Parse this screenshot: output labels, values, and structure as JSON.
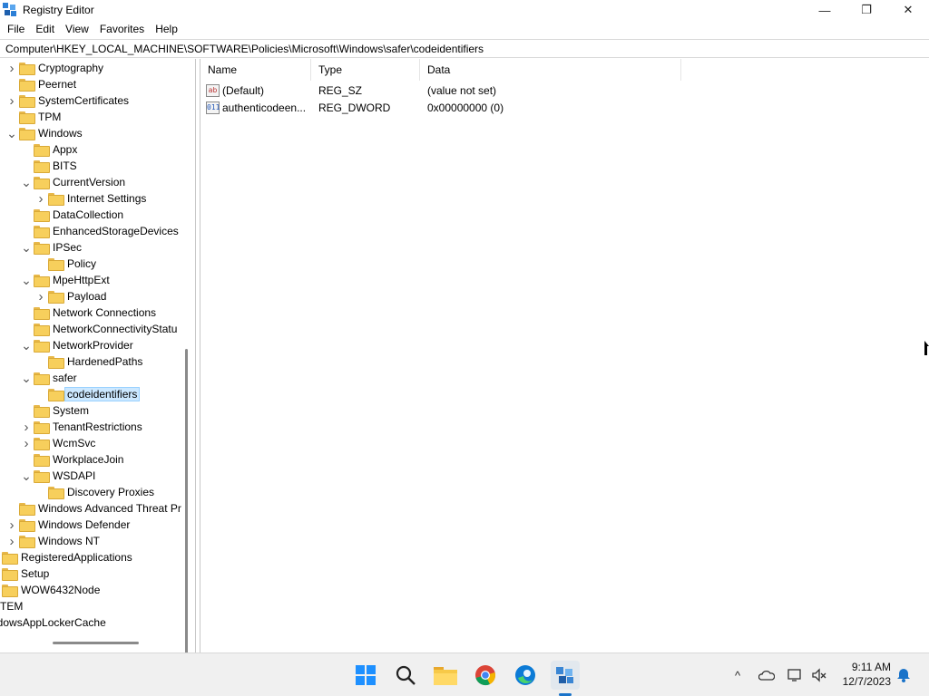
{
  "window": {
    "title": "Registry Editor",
    "minimize": "—",
    "maximize": "❐",
    "close": "✕"
  },
  "menu": [
    "File",
    "Edit",
    "View",
    "Favorites",
    "Help"
  ],
  "address": "Computer\\HKEY_LOCAL_MACHINE\\SOFTWARE\\Policies\\Microsoft\\Windows\\safer\\codeidentifiers",
  "tree": [
    {
      "label": "Cryptography",
      "chevron": "right"
    },
    {
      "label": "Peernet",
      "chevron": ""
    },
    {
      "label": "SystemCertificates",
      "chevron": "right"
    },
    {
      "label": "TPM",
      "chevron": ""
    },
    {
      "label": "Windows",
      "chevron": "down"
    },
    {
      "label": "Appx",
      "chevron": ""
    },
    {
      "label": "BITS",
      "chevron": ""
    },
    {
      "label": "CurrentVersion",
      "chevron": "down"
    },
    {
      "label": "Internet Settings",
      "chevron": "right"
    },
    {
      "label": "DataCollection",
      "chevron": ""
    },
    {
      "label": "EnhancedStorageDevices",
      "chevron": ""
    },
    {
      "label": "IPSec",
      "chevron": "down"
    },
    {
      "label": "Policy",
      "chevron": ""
    },
    {
      "label": "MpeHttpExt",
      "chevron": "down"
    },
    {
      "label": "Payload",
      "chevron": "right"
    },
    {
      "label": "Network Connections",
      "chevron": ""
    },
    {
      "label": "NetworkConnectivityStatu",
      "chevron": ""
    },
    {
      "label": "NetworkProvider",
      "chevron": "down"
    },
    {
      "label": "HardenedPaths",
      "chevron": ""
    },
    {
      "label": "safer",
      "chevron": "down"
    },
    {
      "label": "codeidentifiers",
      "chevron": "",
      "selected": true
    },
    {
      "label": "System",
      "chevron": ""
    },
    {
      "label": "TenantRestrictions",
      "chevron": "right"
    },
    {
      "label": "WcmSvc",
      "chevron": "right"
    },
    {
      "label": "WorkplaceJoin",
      "chevron": ""
    },
    {
      "label": "WSDAPI",
      "chevron": "down"
    },
    {
      "label": "Discovery Proxies",
      "chevron": ""
    },
    {
      "label": "Windows Advanced Threat Pr",
      "chevron": ""
    },
    {
      "label": "Windows Defender",
      "chevron": "right"
    },
    {
      "label": "Windows NT",
      "chevron": "right"
    },
    {
      "label": "RegisteredApplications",
      "chevron": ""
    },
    {
      "label": "Setup",
      "chevron": ""
    },
    {
      "label": "WOW6432Node",
      "chevron": ""
    },
    {
      "label": "YSTEM",
      "chevron": ""
    },
    {
      "label": "/indowsAppLockerCache",
      "chevron": ""
    }
  ],
  "list": {
    "columns": [
      "Name",
      "Type",
      "Data"
    ],
    "rows": [
      {
        "icon": "ab",
        "name": "(Default)",
        "type": "REG_SZ",
        "data": "(value not set)"
      },
      {
        "icon": "011",
        "name": "authenticodeen...",
        "type": "REG_DWORD",
        "data": "0x00000000 (0)"
      }
    ]
  },
  "taskbar": {
    "time": "9:11 AM",
    "date": "12/7/2023",
    "tray_up": "^"
  },
  "colors": {
    "selection": "#cce8ff",
    "folder": "#f7cf5c",
    "taskbar": "#f0f0f0"
  }
}
